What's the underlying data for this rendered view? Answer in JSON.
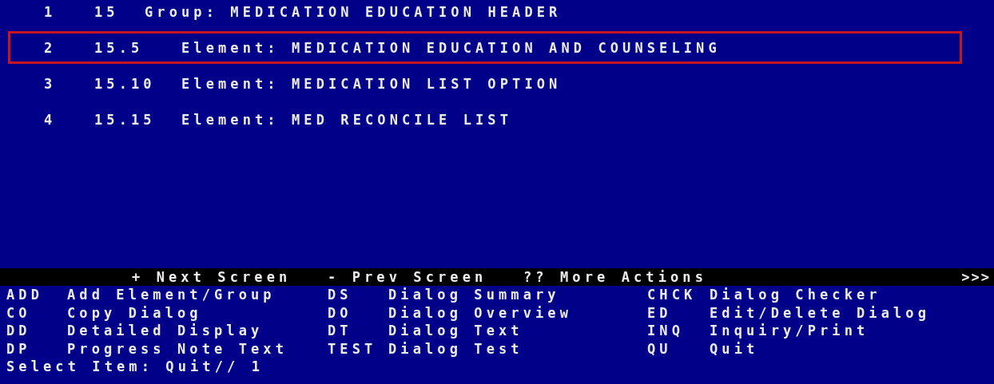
{
  "items": [
    {
      "number": "1",
      "code": "15",
      "kind": "group",
      "description": "Group: MEDICATION EDUCATION HEADER",
      "highlighted": false
    },
    {
      "number": "2",
      "code": "15.5",
      "kind": "element",
      "description": "Element: MEDICATION EDUCATION AND COUNSELING",
      "highlighted": true
    },
    {
      "number": "3",
      "code": "15.10",
      "kind": "element",
      "description": "Element: MEDICATION LIST OPTION",
      "highlighted": false
    },
    {
      "number": "4",
      "code": "15.15",
      "kind": "element",
      "description": "Element: MED RECONCILE LIST",
      "highlighted": false
    }
  ],
  "navigation_bar": {
    "items": [
      "+ Next Screen",
      "- Prev Screen",
      "?? More Actions"
    ],
    "more": ">>>"
  },
  "actions": [
    {
      "code": "ADD",
      "label": "Add Element/Group"
    },
    {
      "code": "DS",
      "label": "Dialog Summary"
    },
    {
      "code": "CHCK",
      "label": "Dialog Checker"
    },
    {
      "code": "CO",
      "label": "Copy Dialog"
    },
    {
      "code": "DO",
      "label": "Dialog Overview"
    },
    {
      "code": "ED",
      "label": "Edit/Delete Dialog"
    },
    {
      "code": "DD",
      "label": "Detailed Display"
    },
    {
      "code": "DT",
      "label": "Dialog Text"
    },
    {
      "code": "INQ",
      "label": "Inquiry/Print"
    },
    {
      "code": "DP",
      "label": "Progress Note Text"
    },
    {
      "code": "TEST",
      "label": "Dialog Test"
    },
    {
      "code": "QU",
      "label": "Quit"
    }
  ],
  "prompt": "Select Item: Quit// 1"
}
